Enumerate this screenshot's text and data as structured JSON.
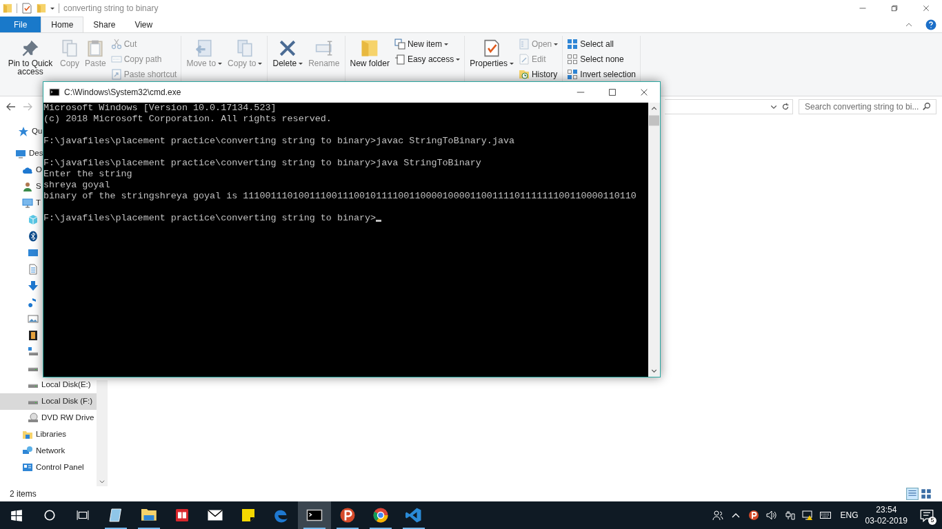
{
  "explorer": {
    "title": "converting string to binary",
    "tabs": [
      {
        "label": "File",
        "kind": "file",
        "selected": false
      },
      {
        "label": "Home",
        "kind": "tab",
        "selected": true
      },
      {
        "label": "Share",
        "kind": "tab",
        "selected": false
      },
      {
        "label": "View",
        "kind": "tab",
        "selected": false
      }
    ],
    "ribbon_groups": [
      {
        "large": [
          {
            "label": "Pin to Quick access",
            "kind": "pin",
            "disabled": false,
            "dropdown": false
          },
          {
            "label": "Copy",
            "kind": "copy",
            "disabled": true,
            "dropdown": false
          },
          {
            "label": "Paste",
            "kind": "paste",
            "disabled": true,
            "dropdown": false
          }
        ],
        "small": [
          {
            "label": "Cut",
            "kind": "cut",
            "disabled": true,
            "dropdown": false
          },
          {
            "label": "Copy path",
            "kind": "copy-path",
            "disabled": true,
            "dropdown": false
          },
          {
            "label": "Paste shortcut",
            "kind": "paste-shortcut",
            "disabled": true,
            "dropdown": false
          }
        ]
      },
      {
        "large": [
          {
            "label": "Move to",
            "kind": "move",
            "disabled": true,
            "dropdown": true
          },
          {
            "label": "Copy to",
            "kind": "copy-to",
            "disabled": true,
            "dropdown": true
          }
        ]
      },
      {
        "large": [
          {
            "label": "Delete",
            "kind": "delete",
            "disabled": false,
            "dropdown": true
          },
          {
            "label": "Rename",
            "kind": "rename",
            "disabled": true,
            "dropdown": false
          }
        ]
      },
      {
        "large": [
          {
            "label": "New folder",
            "kind": "new-folder",
            "disabled": false,
            "dropdown": false
          }
        ],
        "small": [
          {
            "label": "New item",
            "kind": "new-item",
            "disabled": false,
            "dropdown": true
          },
          {
            "label": "Easy access",
            "kind": "easy-access",
            "disabled": false,
            "dropdown": true
          }
        ]
      },
      {
        "large": [
          {
            "label": "Properties",
            "kind": "properties",
            "disabled": false,
            "dropdown": true
          }
        ],
        "small": [
          {
            "label": "Open",
            "kind": "open",
            "disabled": true,
            "dropdown": true
          },
          {
            "label": "Edit",
            "kind": "edit",
            "disabled": true,
            "dropdown": false
          },
          {
            "label": "History",
            "kind": "history",
            "disabled": false,
            "dropdown": false
          }
        ]
      },
      {
        "small": [
          {
            "label": "Select all",
            "kind": "select-all",
            "disabled": false,
            "dropdown": false
          },
          {
            "label": "Select none",
            "kind": "select-none",
            "disabled": false,
            "dropdown": false
          },
          {
            "label": "Invert selection",
            "kind": "invert",
            "disabled": false,
            "dropdown": false
          }
        ]
      }
    ],
    "search": {
      "placeholder": "Search converting string to bi..."
    },
    "nav": [
      {
        "label": "Qu",
        "kind": "star",
        "selected": false
      },
      {
        "label": "Des",
        "kind": "desktop",
        "selected": false,
        "children": [
          {
            "label": "O",
            "kind": "cloud",
            "selected": false
          },
          {
            "label": "S",
            "kind": "person",
            "selected": false
          },
          {
            "label": "T",
            "kind": "pc",
            "selected": false,
            "children": [
              {
                "kind": "cube",
                "selected": false
              },
              {
                "kind": "bluetooth",
                "selected": false
              },
              {
                "kind": "monitor",
                "selected": false
              },
              {
                "kind": "document",
                "selected": false
              },
              {
                "kind": "download",
                "selected": false
              },
              {
                "kind": "music",
                "selected": false
              },
              {
                "kind": "picture",
                "selected": false
              },
              {
                "kind": "film",
                "selected": false
              },
              {
                "kind": "system-drive",
                "selected": false
              },
              {
                "kind": "drive",
                "selected": false
              },
              {
                "label": "Local Disk(E:)",
                "kind": "drive",
                "selected": false
              },
              {
                "label": "Local Disk (F:)",
                "kind": "drive",
                "selected": true
              },
              {
                "label": "DVD RW Drive",
                "kind": "dvd",
                "selected": false
              }
            ]
          },
          {
            "label": "Libraries",
            "kind": "library",
            "selected": false
          },
          {
            "label": "Network",
            "kind": "network",
            "selected": false
          },
          {
            "label": "Control Panel",
            "kind": "control-panel",
            "selected": false
          }
        ]
      }
    ],
    "status": "2 items"
  },
  "cmd": {
    "title": "C:\\Windows\\System32\\cmd.exe",
    "cursor_visible": true,
    "blocks": [
      [
        "Microsoft Windows [Version 10.0.17134.523]",
        "(c) 2018 Microsoft Corporation. All rights reserved."
      ],
      [
        "F:\\javafiles\\placement practice\\converting string to binary>javac StringToBinary.java"
      ],
      [
        "F:\\javafiles\\placement practice\\converting string to binary>java StringToBinary",
        "Enter the string",
        "shreya goyal",
        "binary of the stringshreya goyal is 11100111010011100111001011110011000010000110011110111111100110000110110"
      ],
      [
        "F:\\javafiles\\placement practice\\converting string to binary>"
      ]
    ]
  },
  "taskbar": {
    "apps": [
      {
        "kind": "pad",
        "running": true,
        "active": false
      },
      {
        "kind": "folder",
        "running": true,
        "active": false
      },
      {
        "kind": "book",
        "running": false,
        "active": false
      },
      {
        "kind": "mail",
        "running": false,
        "active": false
      },
      {
        "kind": "sticky",
        "running": false,
        "active": false
      },
      {
        "kind": "edge",
        "running": false,
        "active": false
      },
      {
        "kind": "terminal",
        "running": true,
        "active": true
      },
      {
        "kind": "p-logo",
        "running": true,
        "active": false
      },
      {
        "kind": "chrome",
        "running": true,
        "active": false
      },
      {
        "kind": "vscode",
        "running": true,
        "active": false
      }
    ],
    "language": "ENG",
    "time": "23:54",
    "date": "03-02-2019",
    "notifications": "5"
  }
}
